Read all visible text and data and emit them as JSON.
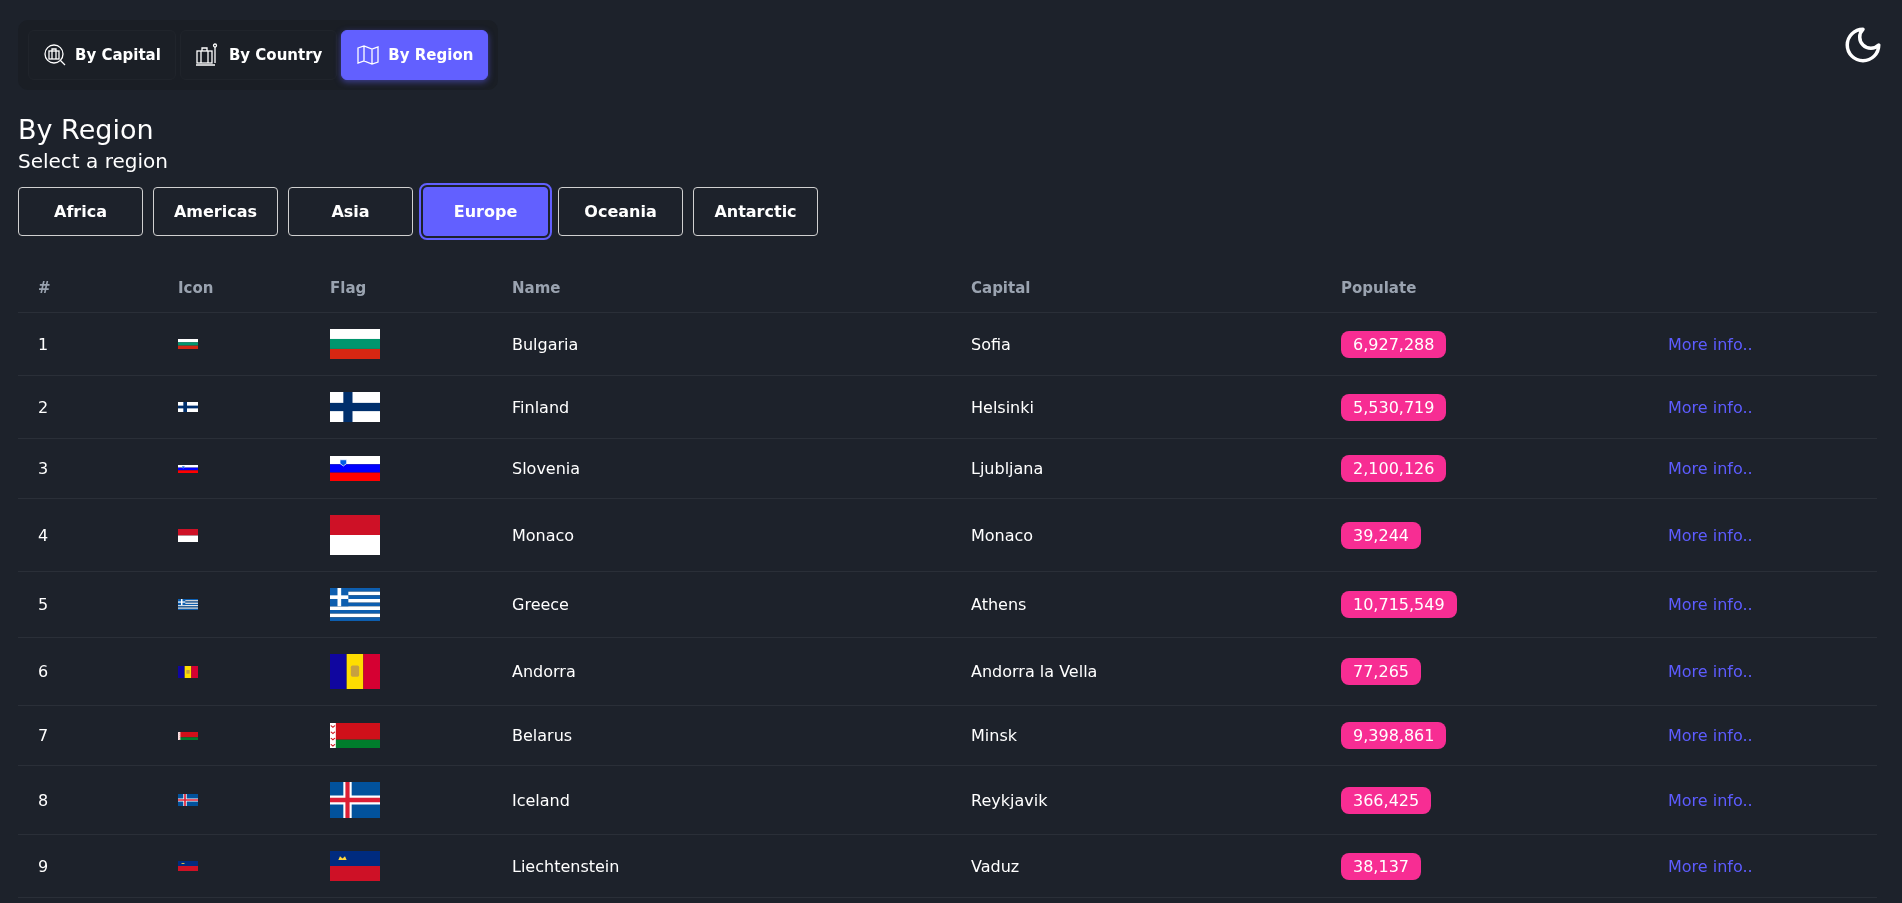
{
  "tabs": [
    {
      "label": "By Capital",
      "kind": "capital",
      "selected": false
    },
    {
      "label": "By Country",
      "kind": "country",
      "selected": false
    },
    {
      "label": "By Region",
      "kind": "region",
      "selected": true
    }
  ],
  "heading": "By Region",
  "subheading": "Select a region",
  "regions": [
    {
      "label": "Africa",
      "selected": false
    },
    {
      "label": "Americas",
      "selected": false
    },
    {
      "label": "Asia",
      "selected": false
    },
    {
      "label": "Europe",
      "selected": true
    },
    {
      "label": "Oceania",
      "selected": false
    },
    {
      "label": "Antarctic",
      "selected": false
    }
  ],
  "table": {
    "columns": [
      "#",
      "Icon",
      "Flag",
      "Name",
      "Capital",
      "Populate"
    ],
    "rows": [
      {
        "number": "1",
        "kind": "bulgaria",
        "name": "Bulgaria",
        "capital": "Sofia",
        "population": "6,927,288",
        "link": "More info.."
      },
      {
        "number": "2",
        "kind": "finland",
        "name": "Finland",
        "capital": "Helsinki",
        "population": "5,530,719",
        "link": "More info.."
      },
      {
        "number": "3",
        "kind": "slovenia",
        "name": "Slovenia",
        "capital": "Ljubljana",
        "population": "2,100,126",
        "link": "More info.."
      },
      {
        "number": "4",
        "kind": "monaco",
        "name": "Monaco",
        "capital": "Monaco",
        "population": "39,244",
        "link": "More info.."
      },
      {
        "number": "5",
        "kind": "greece",
        "name": "Greece",
        "capital": "Athens",
        "population": "10,715,549",
        "link": "More info.."
      },
      {
        "number": "6",
        "kind": "andorra",
        "name": "Andorra",
        "capital": "Andorra la Vella",
        "population": "77,265",
        "link": "More info.."
      },
      {
        "number": "7",
        "kind": "belarus",
        "name": "Belarus",
        "capital": "Minsk",
        "population": "9,398,861",
        "link": "More info.."
      },
      {
        "number": "8",
        "kind": "iceland",
        "name": "Iceland",
        "capital": "Reykjavik",
        "population": "366,425",
        "link": "More info.."
      },
      {
        "number": "9",
        "kind": "liechtenstein",
        "name": "Liechtenstein",
        "capital": "Vaduz",
        "population": "38,137",
        "link": "More info.."
      }
    ]
  }
}
